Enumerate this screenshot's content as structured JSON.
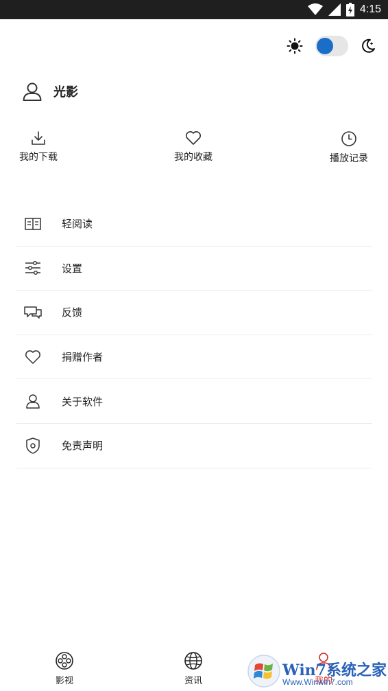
{
  "status_bar": {
    "time": "4:15"
  },
  "profile": {
    "name": "光影"
  },
  "quick_actions": [
    {
      "label": "我的下载",
      "icon": "download-icon"
    },
    {
      "label": "我的收藏",
      "icon": "heart-icon"
    },
    {
      "label": "播放记录",
      "icon": "clock-icon"
    }
  ],
  "menu": [
    {
      "label": "轻阅读",
      "icon": "book-icon"
    },
    {
      "label": "设置",
      "icon": "sliders-icon"
    },
    {
      "label": "反馈",
      "icon": "chat-icon"
    },
    {
      "label": "捐赠作者",
      "icon": "heart-icon"
    },
    {
      "label": "关于软件",
      "icon": "user-icon"
    },
    {
      "label": "免责声明",
      "icon": "shield-icon"
    }
  ],
  "tabs": [
    {
      "label": "影视",
      "icon": "film-reel-icon"
    },
    {
      "label": "资讯",
      "icon": "globe-icon"
    },
    {
      "label": "我的",
      "icon": "person-icon",
      "active": true
    }
  ],
  "theme": {
    "accent": "#1a6ec7",
    "active_tab_color": "#d62b2b",
    "dark_mode": false
  },
  "watermark": {
    "text": "Win7系统之家",
    "url": "Www.Winwin7.com"
  }
}
